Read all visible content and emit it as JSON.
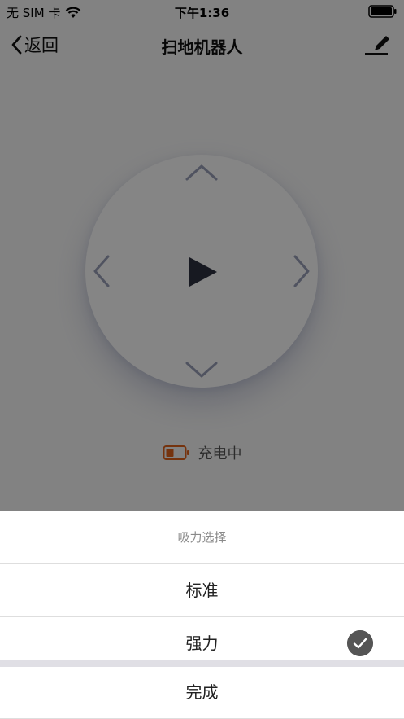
{
  "status_bar": {
    "carrier": "无 SIM 卡",
    "time": "下午1:36",
    "wifi_icon": "wifi-icon",
    "battery_icon": "battery-full-icon"
  },
  "nav": {
    "back_label": "返回",
    "title": "扫地机器人",
    "edit_icon": "edit-pen-icon"
  },
  "control_pad": {
    "up_icon": "chevron-up-icon",
    "down_icon": "chevron-down-icon",
    "left_icon": "chevron-left-icon",
    "right_icon": "chevron-right-icon",
    "play_icon": "play-icon"
  },
  "status": {
    "charging_text": "充电中",
    "battery_icon": "battery-low-icon",
    "battery_color": "#e0621c"
  },
  "sheet": {
    "title": "吸力选择",
    "options": [
      {
        "label": "标准",
        "selected": false
      },
      {
        "label": "强力",
        "selected": true
      }
    ],
    "done_label": "完成"
  }
}
